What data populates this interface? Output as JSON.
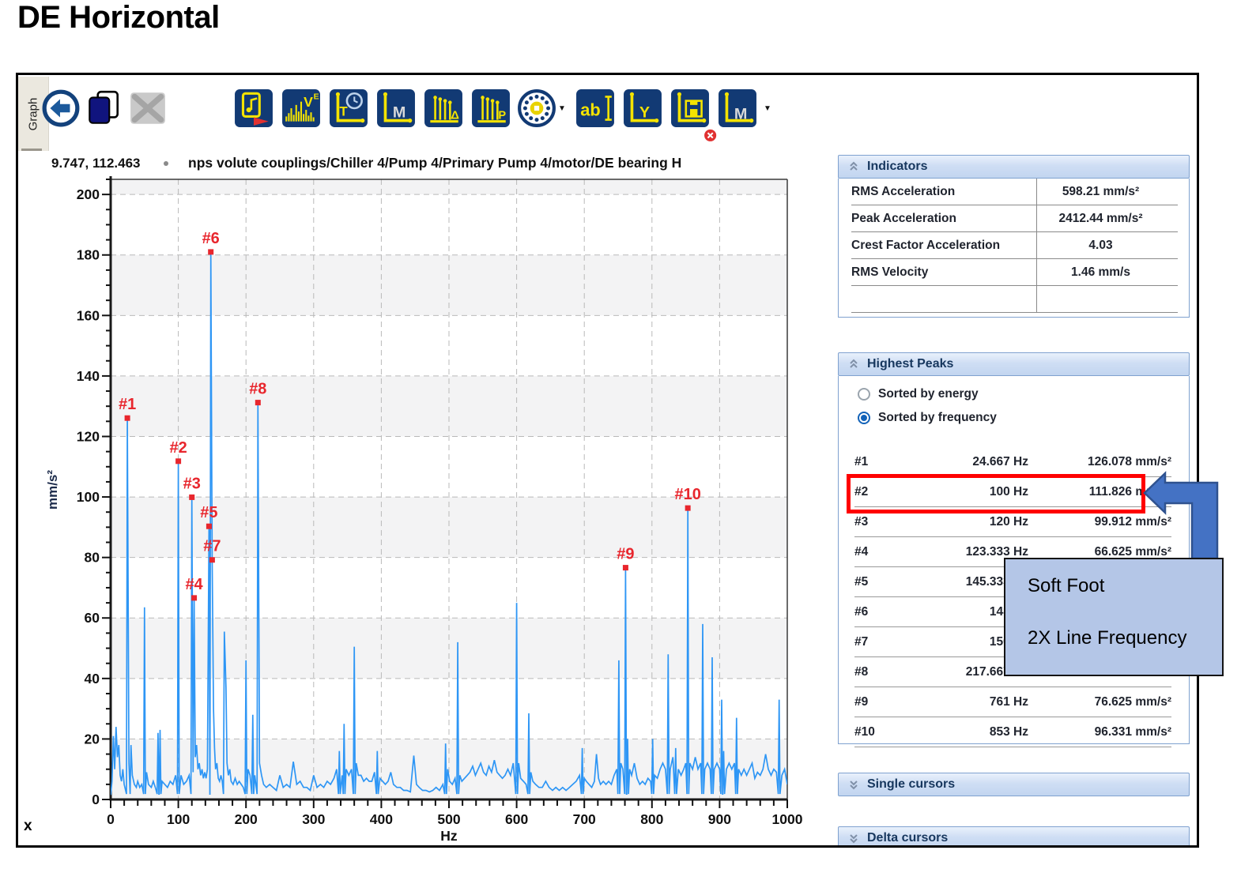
{
  "page": {
    "title": "DE Horizontal"
  },
  "toolbar": {
    "tab_label": "Graph",
    "buttons": [
      {
        "name": "back-button",
        "type": "back"
      },
      {
        "name": "copy-graph-button",
        "type": "copy",
        "gap": 4
      },
      {
        "name": "delete-graph-button",
        "type": "delete",
        "gap": 6
      },
      {
        "name": "export-audio-button",
        "type": "doc-note",
        "gap": 84
      },
      {
        "name": "velocity-spectrum-button",
        "type": "bars",
        "letter": "V",
        "sup": "E",
        "gap": 10
      },
      {
        "name": "time-waveform-button",
        "type": "axis-clock",
        "letter": "T",
        "gap": 10
      },
      {
        "name": "markers-button",
        "type": "axis",
        "letter": "M",
        "pale": true,
        "gap": 10
      },
      {
        "name": "delta-cursors-button",
        "type": "axis-cursors",
        "letter": "Δ",
        "gap": 10
      },
      {
        "name": "peak-cursors-button",
        "type": "axis-cursors",
        "letter": "P",
        "gap": 10
      },
      {
        "name": "bearing-button",
        "type": "bearing",
        "gap": 8
      },
      {
        "name": "bearing-dropdown",
        "type": "caret",
        "gap": 0
      },
      {
        "name": "label-button",
        "type": "text",
        "letter": "ab",
        "gap": 10
      },
      {
        "name": "y-axis-button",
        "type": "axis",
        "letter": "Y",
        "gap": 10
      },
      {
        "name": "save-graph-button",
        "type": "axis-save",
        "gap": 10
      },
      {
        "name": "marker-remove-button",
        "type": "axis-badge",
        "letter": "M",
        "pale": true,
        "gap": 10
      },
      {
        "name": "marker-remove-dropdown",
        "type": "caret",
        "gap": 6
      }
    ]
  },
  "chart": {
    "cursor_readout": "9.747, 112.463",
    "title_path": "nps volute couplings/Chiller 4/Pump 4/Primary Pump 4/motor/DE bearing H",
    "xlabel": "Hz",
    "ylabel": "mm/s²",
    "corner_label": "x"
  },
  "chart_data": {
    "type": "line",
    "title": "nps volute couplings/Chiller 4/Pump 4/Primary Pump 4/motor/DE bearing H",
    "xlabel": "Hz",
    "ylabel": "mm/s²",
    "x_range": [
      0,
      1000
    ],
    "y_range": [
      0,
      205
    ],
    "x_ticks": [
      0,
      100,
      200,
      300,
      400,
      500,
      600,
      700,
      800,
      900,
      1000
    ],
    "y_ticks": [
      0,
      20,
      40,
      60,
      80,
      100,
      120,
      140,
      160,
      180,
      200
    ],
    "grid": "dashed",
    "noise_floor": 1.8,
    "trace_color": "#2e96f5",
    "marker_color": "#e8262d",
    "peaks": [
      {
        "rank": "#1",
        "freq": 24.667,
        "amp": 126.078
      },
      {
        "rank": "#2",
        "freq": 100,
        "amp": 111.826
      },
      {
        "rank": "#3",
        "freq": 120,
        "amp": 99.912
      },
      {
        "rank": "#4",
        "freq": 123.333,
        "amp": 66.625
      },
      {
        "rank": "#5",
        "freq": 145.333,
        "amp": 90.3
      },
      {
        "rank": "#6",
        "freq": 148,
        "amp": 181.0
      },
      {
        "rank": "#7",
        "freq": 150,
        "amp": 79.2
      },
      {
        "rank": "#8",
        "freq": 217.667,
        "amp": 131.2
      },
      {
        "rank": "#9",
        "freq": 761,
        "amp": 76.625
      },
      {
        "rank": "#10",
        "freq": 853,
        "amp": 96.331
      }
    ],
    "samples": [
      [
        2,
        6
      ],
      [
        4,
        21
      ],
      [
        6,
        10
      ],
      [
        8,
        24
      ],
      [
        10,
        14
      ],
      [
        12,
        18
      ],
      [
        14,
        8
      ],
      [
        16,
        6
      ],
      [
        18,
        10
      ],
      [
        20,
        5
      ],
      [
        24.667,
        126.078
      ],
      [
        27,
        12
      ],
      [
        30,
        18
      ],
      [
        32,
        8
      ],
      [
        35,
        5
      ],
      [
        38,
        4
      ],
      [
        40,
        6
      ],
      [
        43,
        4
      ],
      [
        46,
        5
      ],
      [
        50,
        63.5
      ],
      [
        53,
        9
      ],
      [
        56,
        5
      ],
      [
        60,
        4
      ],
      [
        63,
        6
      ],
      [
        66,
        4
      ],
      [
        70,
        22
      ],
      [
        73,
        23
      ],
      [
        76,
        6
      ],
      [
        80,
        5
      ],
      [
        84,
        4
      ],
      [
        88,
        6
      ],
      [
        92,
        5
      ],
      [
        96,
        8
      ],
      [
        100,
        111.826
      ],
      [
        104,
        8
      ],
      [
        108,
        5
      ],
      [
        112,
        6
      ],
      [
        116,
        8
      ],
      [
        120,
        99.912
      ],
      [
        121.8,
        9
      ],
      [
        123.333,
        66.625
      ],
      [
        125,
        14
      ],
      [
        127,
        18
      ],
      [
        129,
        10
      ],
      [
        131,
        12
      ],
      [
        133,
        8
      ],
      [
        135,
        10
      ],
      [
        137,
        7
      ],
      [
        139,
        9
      ],
      [
        141,
        7
      ],
      [
        143,
        10
      ],
      [
        145.333,
        90.3
      ],
      [
        148,
        181
      ],
      [
        150,
        79.2
      ],
      [
        152,
        30
      ],
      [
        153.5,
        17
      ],
      [
        155,
        10
      ],
      [
        157,
        12
      ],
      [
        159,
        7
      ],
      [
        161,
        6
      ],
      [
        163,
        8
      ],
      [
        165,
        6
      ],
      [
        168,
        55.5
      ],
      [
        170.5,
        37
      ],
      [
        172,
        12
      ],
      [
        174,
        8
      ],
      [
        176,
        10
      ],
      [
        178,
        6
      ],
      [
        181,
        5
      ],
      [
        184,
        7
      ],
      [
        187,
        5
      ],
      [
        190,
        6
      ],
      [
        193,
        5
      ],
      [
        196,
        4
      ],
      [
        200,
        46
      ],
      [
        203,
        10
      ],
      [
        206,
        8
      ],
      [
        210,
        28
      ],
      [
        213,
        8
      ],
      [
        217.667,
        131.2
      ],
      [
        220,
        12
      ],
      [
        223,
        8
      ],
      [
        226,
        5
      ],
      [
        230,
        4
      ],
      [
        235,
        5
      ],
      [
        240,
        4
      ],
      [
        245,
        3
      ],
      [
        250,
        8
      ],
      [
        255,
        4
      ],
      [
        260,
        5
      ],
      [
        265,
        4
      ],
      [
        270,
        12.5
      ],
      [
        275,
        5
      ],
      [
        280,
        6
      ],
      [
        285,
        4
      ],
      [
        290,
        4
      ],
      [
        295,
        3
      ],
      [
        300,
        8
      ],
      [
        305,
        4
      ],
      [
        310,
        5
      ],
      [
        315,
        4
      ],
      [
        320,
        6
      ],
      [
        325,
        5
      ],
      [
        330,
        7
      ],
      [
        334,
        10
      ],
      [
        338,
        16
      ],
      [
        342,
        8
      ],
      [
        345,
        25
      ],
      [
        348,
        10
      ],
      [
        352,
        8
      ],
      [
        356,
        10
      ],
      [
        360,
        50.5
      ],
      [
        363,
        12
      ],
      [
        366,
        8
      ],
      [
        370,
        8
      ],
      [
        374,
        6
      ],
      [
        378,
        7
      ],
      [
        382,
        6
      ],
      [
        386,
        6
      ],
      [
        390,
        9
      ],
      [
        394,
        16
      ],
      [
        398,
        7
      ],
      [
        402,
        6
      ],
      [
        406,
        5
      ],
      [
        410,
        6
      ],
      [
        414,
        9
      ],
      [
        418,
        5
      ],
      [
        423,
        4
      ],
      [
        428,
        4
      ],
      [
        433,
        3
      ],
      [
        438,
        3
      ],
      [
        443,
        2.5
      ],
      [
        448,
        14.5
      ],
      [
        452,
        5
      ],
      [
        456,
        4
      ],
      [
        461,
        3
      ],
      [
        466,
        3
      ],
      [
        471,
        2.5
      ],
      [
        476,
        3
      ],
      [
        481,
        4
      ],
      [
        486,
        3
      ],
      [
        491,
        5
      ],
      [
        495,
        18.5
      ],
      [
        498,
        10
      ],
      [
        501,
        6
      ],
      [
        505,
        5
      ],
      [
        509,
        7
      ],
      [
        513,
        52
      ],
      [
        516,
        8
      ],
      [
        519,
        6
      ],
      [
        523,
        7
      ],
      [
        527,
        8
      ],
      [
        531,
        9
      ],
      [
        535,
        11
      ],
      [
        539,
        8
      ],
      [
        543,
        10
      ],
      [
        547,
        12
      ],
      [
        551,
        9
      ],
      [
        555,
        8
      ],
      [
        559,
        11
      ],
      [
        563,
        9
      ],
      [
        567,
        13
      ],
      [
        571,
        9
      ],
      [
        575,
        8
      ],
      [
        579,
        7
      ],
      [
        583,
        8
      ],
      [
        587,
        10
      ],
      [
        591,
        8
      ],
      [
        595,
        12
      ],
      [
        600,
        65
      ],
      [
        603,
        12
      ],
      [
        606,
        7
      ],
      [
        610,
        6
      ],
      [
        614,
        5
      ],
      [
        618,
        28.5
      ],
      [
        621,
        9
      ],
      [
        624,
        6
      ],
      [
        628,
        5
      ],
      [
        633,
        4
      ],
      [
        638,
        4
      ],
      [
        643,
        6
      ],
      [
        648,
        4
      ],
      [
        653,
        3
      ],
      [
        658,
        4
      ],
      [
        663,
        3
      ],
      [
        668,
        4
      ],
      [
        673,
        3
      ],
      [
        678,
        4
      ],
      [
        683,
        5
      ],
      [
        688,
        6
      ],
      [
        693,
        8
      ],
      [
        697,
        17
      ],
      [
        700,
        7
      ],
      [
        703,
        6
      ],
      [
        707,
        5
      ],
      [
        711,
        4
      ],
      [
        715,
        6
      ],
      [
        718,
        15
      ],
      [
        721,
        7
      ],
      [
        724,
        5
      ],
      [
        728,
        6
      ],
      [
        732,
        5
      ],
      [
        736,
        6
      ],
      [
        740,
        5
      ],
      [
        744,
        8
      ],
      [
        748,
        10
      ],
      [
        751,
        46
      ],
      [
        754,
        12
      ],
      [
        757,
        10
      ],
      [
        761,
        76.625
      ],
      [
        764,
        20
      ],
      [
        767,
        10
      ],
      [
        770,
        8
      ],
      [
        774,
        12
      ],
      [
        778,
        7
      ],
      [
        782,
        5
      ],
      [
        786,
        6
      ],
      [
        790,
        5
      ],
      [
        794,
        7
      ],
      [
        798,
        6
      ],
      [
        801,
        20
      ],
      [
        804,
        8
      ],
      [
        808,
        7
      ],
      [
        812,
        10
      ],
      [
        816,
        12
      ],
      [
        820,
        10
      ],
      [
        824,
        48
      ],
      [
        827,
        10
      ],
      [
        831,
        14
      ],
      [
        835,
        17
      ],
      [
        839,
        10
      ],
      [
        843,
        8
      ],
      [
        847,
        10
      ],
      [
        850,
        12
      ],
      [
        853,
        96.331
      ],
      [
        856,
        12
      ],
      [
        860,
        10
      ],
      [
        864,
        14
      ],
      [
        868,
        10
      ],
      [
        872,
        12
      ],
      [
        875,
        58
      ],
      [
        878,
        10
      ],
      [
        882,
        12
      ],
      [
        886,
        10
      ],
      [
        889,
        47
      ],
      [
        892,
        10
      ],
      [
        896,
        12
      ],
      [
        900,
        10
      ],
      [
        903,
        33
      ],
      [
        906,
        16
      ],
      [
        910,
        10
      ],
      [
        914,
        12
      ],
      [
        918,
        10
      ],
      [
        922,
        12
      ],
      [
        925,
        27
      ],
      [
        928,
        10
      ],
      [
        932,
        8
      ],
      [
        936,
        10
      ],
      [
        940,
        8
      ],
      [
        944,
        10
      ],
      [
        948,
        12
      ],
      [
        952,
        7
      ],
      [
        956,
        9
      ],
      [
        960,
        8
      ],
      [
        964,
        10
      ],
      [
        968,
        15
      ],
      [
        972,
        10
      ],
      [
        976,
        8
      ],
      [
        980,
        10
      ],
      [
        984,
        9
      ],
      [
        988,
        33
      ],
      [
        992,
        8
      ],
      [
        996,
        10
      ],
      [
        1000,
        5
      ]
    ]
  },
  "sidebar": {
    "indicators": {
      "title": "Indicators",
      "rows": [
        {
          "label": "RMS Acceleration",
          "value": "598.21 mm/s²"
        },
        {
          "label": "Peak Acceleration",
          "value": "2412.44 mm/s²"
        },
        {
          "label": "Crest Factor Acceleration",
          "value": "4.03"
        },
        {
          "label": "RMS Velocity",
          "value": "1.46 mm/s"
        },
        {
          "label": "",
          "value": ""
        }
      ]
    },
    "highest_peaks": {
      "title": "Highest Peaks",
      "sort_options": [
        {
          "label": "Sorted by energy",
          "selected": false
        },
        {
          "label": "Sorted by frequency",
          "selected": true
        }
      ],
      "rows": [
        {
          "rank": "#1",
          "freq": "24.667 Hz",
          "amp": "126.078 mm/s²"
        },
        {
          "rank": "#2",
          "freq": "100 Hz",
          "amp": "111.826 mm/s²"
        },
        {
          "rank": "#3",
          "freq": "120 Hz",
          "amp": "99.912 mm/s²"
        },
        {
          "rank": "#4",
          "freq": "123.333 Hz",
          "amp": "66.625 mm/s²"
        },
        {
          "rank": "#5",
          "freq": "145.333 Hz",
          "amp": ""
        },
        {
          "rank": "#6",
          "freq": "148 Hz",
          "amp": ""
        },
        {
          "rank": "#7",
          "freq": "150 Hz",
          "amp": ""
        },
        {
          "rank": "#8",
          "freq": "217.667 Hz",
          "amp": ""
        },
        {
          "rank": "#9",
          "freq": "761 Hz",
          "amp": "76.625 mm/s²"
        },
        {
          "rank": "#10",
          "freq": "853 Hz",
          "amp": "96.331 mm/s²"
        }
      ]
    },
    "single_cursors": {
      "title": "Single cursors"
    },
    "delta_cursors": {
      "title": "Delta cursors"
    }
  },
  "annotations": {
    "lines": [
      "Soft Foot",
      "2X Line Frequency"
    ],
    "highlight_color": "#ff0000",
    "arrow_fill": "#4472c4",
    "arrow_border": "#2f528f",
    "callout_bg": "#b4c6e7"
  },
  "colors": {
    "toolbar_navy": "#123a74",
    "icon_yellow": "#f4e300",
    "panel_border": "#7fa1cf",
    "band_gray": "#f3f3f4"
  }
}
